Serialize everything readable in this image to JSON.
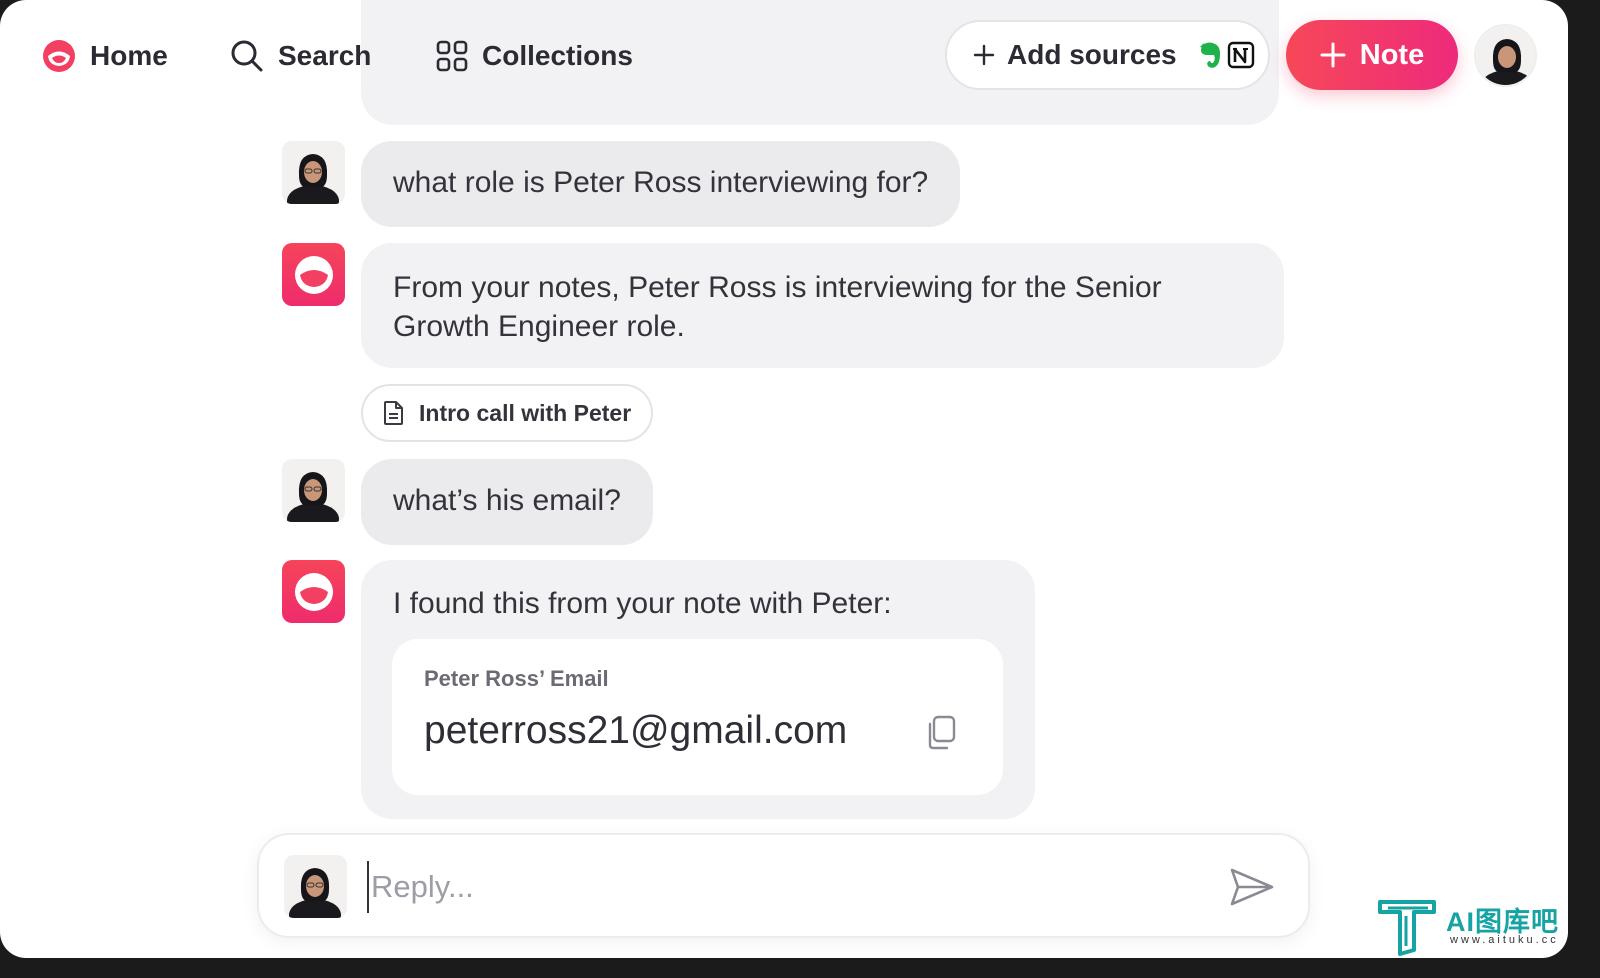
{
  "nav": {
    "home": "Home",
    "search": "Search",
    "collections": "Collections",
    "add_sources": "Add sources",
    "note": "Note"
  },
  "conversation": {
    "previous_message_faded": "",
    "user_question_1": "what role is Peter Ross interviewing for?",
    "bot_answer_1": "From your notes, Peter Ross is interviewing for the Senior Growth Engineer role.",
    "source_chip": "Intro call with Peter",
    "user_question_2": "what’s his email?",
    "bot_answer_2": "I found this from your note with Peter:",
    "email_card": {
      "label": "Peter Ross’ Email",
      "value": "peterross21@gmail.com"
    }
  },
  "reply": {
    "placeholder": "Reply..."
  },
  "watermark": {
    "title": "AI图库吧",
    "url": "www.aituku.cc"
  },
  "colors": {
    "brand": "#f23f62",
    "bubble": "#f2f2f4",
    "user_bubble": "#ebebee"
  },
  "icons": {
    "home": "home-logo-icon",
    "search": "search-icon",
    "collections": "grid-icon",
    "add": "plus-icon",
    "evernote": "evernote-icon",
    "notion": "notion-icon",
    "document": "document-icon",
    "copy": "copy-icon",
    "send": "send-icon"
  }
}
